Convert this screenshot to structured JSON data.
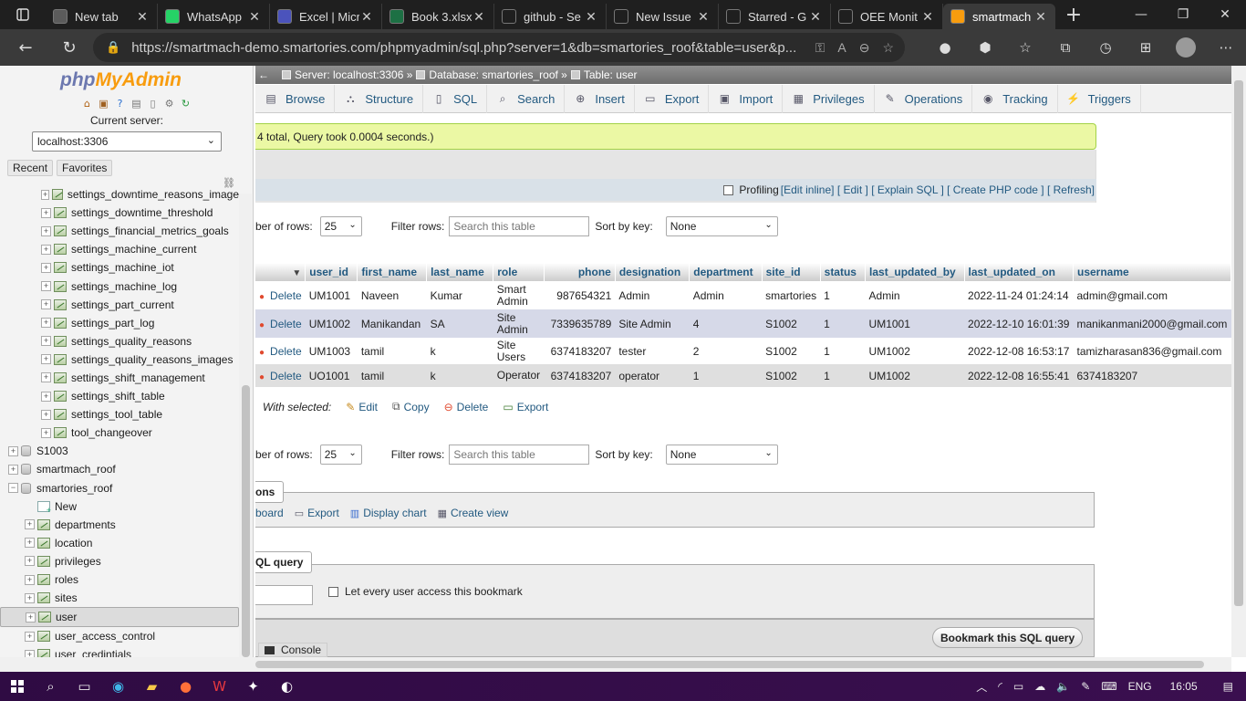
{
  "browser": {
    "tabs": [
      {
        "title": "New tab",
        "icon": "newtab-icon",
        "color": "#5b5b5b"
      },
      {
        "title": "WhatsApp",
        "icon": "whatsapp-icon",
        "color": "#25d366"
      },
      {
        "title": "Excel | Micr",
        "icon": "excel-online-icon",
        "color": "#4b53bc"
      },
      {
        "title": "Book 3.xlsx",
        "icon": "excel-icon",
        "color": "#1d7044"
      },
      {
        "title": "github - Se",
        "icon": "search-icon",
        "color": "#1f1f1f"
      },
      {
        "title": "New Issue",
        "icon": "github-icon",
        "color": "#1f1f1f"
      },
      {
        "title": "Starred - G",
        "icon": "google-drive-icon",
        "color": "#1f1f1f"
      },
      {
        "title": "OEE Monit",
        "icon": "document-icon",
        "color": "#1f1f1f"
      },
      {
        "title": "smartmach",
        "icon": "phpmyadmin-icon",
        "color": "#f89c0e"
      }
    ],
    "url": "https://smartmach-demo.smartories.com/phpmyadmin/sql.php?server=1&db=smartories_roof&table=user&p..."
  },
  "left_panel": {
    "logo_part1": "php",
    "logo_part2": "MyAdmin",
    "current_server_label": "Current server:",
    "server_value": "localhost:3306",
    "tabs": [
      "Recent",
      "Favorites"
    ],
    "tree": [
      {
        "label": "settings_downtime_reasons_image",
        "type": "table",
        "level": 2
      },
      {
        "label": "settings_downtime_threshold",
        "type": "table",
        "level": 2
      },
      {
        "label": "settings_financial_metrics_goals",
        "type": "table",
        "level": 2
      },
      {
        "label": "settings_machine_current",
        "type": "table",
        "level": 2
      },
      {
        "label": "settings_machine_iot",
        "type": "table",
        "level": 2
      },
      {
        "label": "settings_machine_log",
        "type": "table",
        "level": 2
      },
      {
        "label": "settings_part_current",
        "type": "table",
        "level": 2
      },
      {
        "label": "settings_part_log",
        "type": "table",
        "level": 2
      },
      {
        "label": "settings_quality_reasons",
        "type": "table",
        "level": 2
      },
      {
        "label": "settings_quality_reasons_images",
        "type": "table",
        "level": 2
      },
      {
        "label": "settings_shift_management",
        "type": "table",
        "level": 2
      },
      {
        "label": "settings_shift_table",
        "type": "table",
        "level": 2
      },
      {
        "label": "settings_tool_table",
        "type": "table",
        "level": 2
      },
      {
        "label": "tool_changeover",
        "type": "table",
        "level": 2
      },
      {
        "label": "S1003",
        "type": "db",
        "level": 0
      },
      {
        "label": "smartmach_roof",
        "type": "db",
        "level": 0
      },
      {
        "label": "smartories_roof",
        "type": "db",
        "level": 0,
        "expanded": true
      },
      {
        "label": "New",
        "type": "new",
        "level": 1
      },
      {
        "label": "departments",
        "type": "table",
        "level": 1
      },
      {
        "label": "location",
        "type": "table",
        "level": 1
      },
      {
        "label": "privileges",
        "type": "table",
        "level": 1
      },
      {
        "label": "roles",
        "type": "table",
        "level": 1
      },
      {
        "label": "sites",
        "type": "table",
        "level": 1
      },
      {
        "label": "user",
        "type": "table",
        "level": 1,
        "selected": true
      },
      {
        "label": "user_access_control",
        "type": "table",
        "level": 1
      },
      {
        "label": "user_credintials",
        "type": "table",
        "level": 1
      }
    ]
  },
  "breadcrumb": {
    "server": "Server: localhost:3306",
    "database": "Database: smartories_roof",
    "table": "Table: user"
  },
  "menu": [
    {
      "label": "Browse",
      "icon": "browse-icon"
    },
    {
      "label": "Structure",
      "icon": "structure-icon"
    },
    {
      "label": "SQL",
      "icon": "sql-icon"
    },
    {
      "label": "Search",
      "icon": "search-icon"
    },
    {
      "label": "Insert",
      "icon": "insert-icon"
    },
    {
      "label": "Export",
      "icon": "export-icon"
    },
    {
      "label": "Import",
      "icon": "import-icon"
    },
    {
      "label": "Privileges",
      "icon": "privileges-icon"
    },
    {
      "label": "Operations",
      "icon": "operations-icon"
    },
    {
      "label": "Tracking",
      "icon": "tracking-icon"
    },
    {
      "label": "Triggers",
      "icon": "triggers-icon"
    }
  ],
  "query_result": {
    "message": "4 total, Query took 0.0004 seconds.)",
    "profiling_label": "Profiling",
    "profiling_links": [
      "[Edit inline]",
      "[ Edit ]",
      "[ Explain SQL ]",
      "[ Create PHP code ]",
      "[ Refresh]"
    ]
  },
  "navigation": {
    "rows_label": "ber of rows:",
    "rows_value": "25",
    "filter_label": "Filter rows:",
    "filter_placeholder": "Search this table",
    "sort_label": "Sort by key:",
    "sort_value": "None"
  },
  "table": {
    "columns": [
      "user_id",
      "first_name",
      "last_name",
      "role",
      "phone",
      "designation",
      "department",
      "site_id",
      "status",
      "last_updated_by",
      "last_updated_on",
      "username"
    ],
    "delete_label": "Delete",
    "rows": [
      [
        "UM1001",
        "Naveen",
        "Kumar",
        "Smart Admin",
        "987654321",
        "Admin",
        "Admin",
        "smartories",
        "1",
        "Admin",
        "2022-11-24 01:24:14",
        "admin@gmail.com"
      ],
      [
        "UM1002",
        "Manikandan",
        "SA",
        "Site Admin",
        "7339635789",
        "Site Admin",
        "4",
        "S1002",
        "1",
        "UM1001",
        "2022-12-10 16:01:39",
        "manikanmani2000@gmail.com"
      ],
      [
        "UM1003",
        "tamil",
        "k",
        "Site Users",
        "6374183207",
        "tester",
        "2",
        "S1002",
        "1",
        "UM1002",
        "2022-12-08 16:53:17",
        "tamizharasan836@gmail.com"
      ],
      [
        "UO1001",
        "tamil",
        "k",
        "Operator",
        "6374183207",
        "operator",
        "1",
        "S1002",
        "1",
        "UM1002",
        "2022-12-08 16:55:41",
        "6374183207"
      ]
    ]
  },
  "with_selected": {
    "label": "With selected:",
    "actions": [
      {
        "label": "Edit",
        "icon": "pencil-icon"
      },
      {
        "label": "Copy",
        "icon": "copy-icon"
      },
      {
        "label": "Delete",
        "icon": "delete-icon"
      },
      {
        "label": "Export",
        "icon": "export-icon"
      }
    ]
  },
  "operations": {
    "legend": "ons",
    "links": [
      "board",
      "Export",
      "Display chart",
      "Create view"
    ]
  },
  "bookmark": {
    "legend": "QL query",
    "share_label": "Let every user access this bookmark",
    "button": "Bookmark this SQL query"
  },
  "console_label": "Console",
  "taskbar": {
    "language": "ENG",
    "time": "16:05"
  }
}
